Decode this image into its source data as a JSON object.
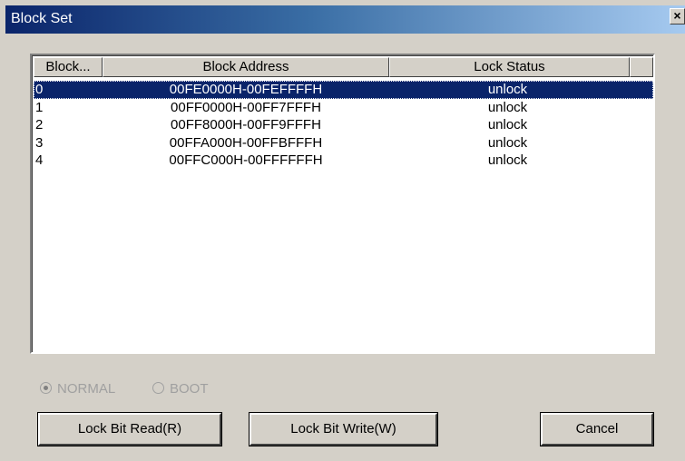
{
  "window": {
    "title": "Block Set",
    "close_glyph": "×"
  },
  "table": {
    "columns": [
      "Block...",
      "Block Address",
      "Lock Status"
    ],
    "rows": [
      {
        "block": "0",
        "address": "00FE0000H-00FEFFFFH",
        "status": "unlock"
      },
      {
        "block": "1",
        "address": "00FF0000H-00FF7FFFH",
        "status": "unlock"
      },
      {
        "block": "2",
        "address": "00FF8000H-00FF9FFFH",
        "status": "unlock"
      },
      {
        "block": "3",
        "address": "00FFA000H-00FFBFFFH",
        "status": "unlock"
      },
      {
        "block": "4",
        "address": "00FFC000H-00FFFFFFH",
        "status": "unlock"
      }
    ],
    "selected_row": 0
  },
  "mode": {
    "normal_label": "NORMAL",
    "boot_label": "BOOT",
    "selected": "NORMAL"
  },
  "buttons": {
    "lock_read": "Lock Bit Read(R)",
    "lock_write": "Lock Bit Write(W)",
    "cancel": "Cancel"
  },
  "colors": {
    "title_bar": "#0a246a",
    "selection": "#0a246a",
    "dialog_bg": "#d4d0c8"
  },
  "icons": {
    "close": "close-icon"
  }
}
